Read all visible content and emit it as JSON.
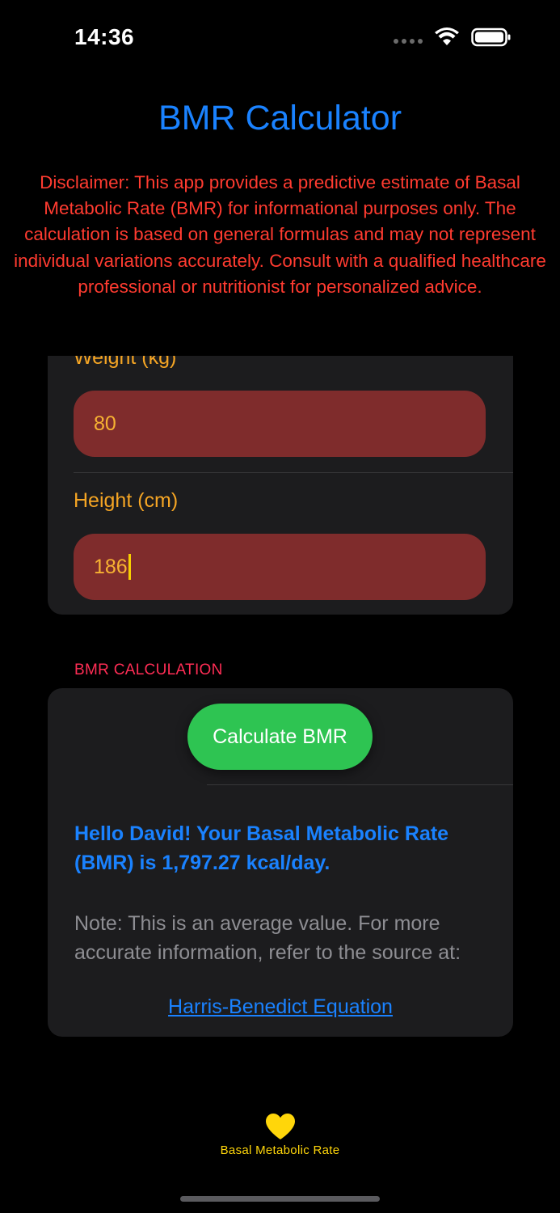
{
  "status_bar": {
    "time": "14:36"
  },
  "header": {
    "title": "BMR Calculator",
    "disclaimer": "Disclaimer: This app provides a predictive estimate of Basal Metabolic Rate (BMR) for informational purposes only. The calculation is based on general formulas and may not represent individual variations accurately. Consult with a qualified healthcare professional or nutritionist for personalized advice."
  },
  "form": {
    "weight_label": "Weight (kg)",
    "weight_value": "80",
    "height_label": "Height (cm)",
    "height_value": "186"
  },
  "calculation": {
    "section_title": "BMR CALCULATION",
    "button_label": "Calculate BMR",
    "result": "Hello David! Your Basal Metabolic Rate (BMR) is 1,797.27 kcal/day.",
    "note": "Note: This is an average value. For more accurate information, refer to the source at:",
    "source_link": "Harris-Benedict Equation"
  },
  "tab_bar": {
    "items": [
      {
        "label": "Basal Metabolic Rate",
        "icon": "heart-icon"
      }
    ]
  },
  "colors": {
    "accent_blue": "#1a82ff",
    "disclaimer_red": "#ff3b30",
    "label_orange": "#f5a524",
    "input_bg": "#7f2c2c",
    "button_green": "#2ec452",
    "section_pink": "#ff2d55",
    "tab_yellow": "#ffd60a"
  }
}
